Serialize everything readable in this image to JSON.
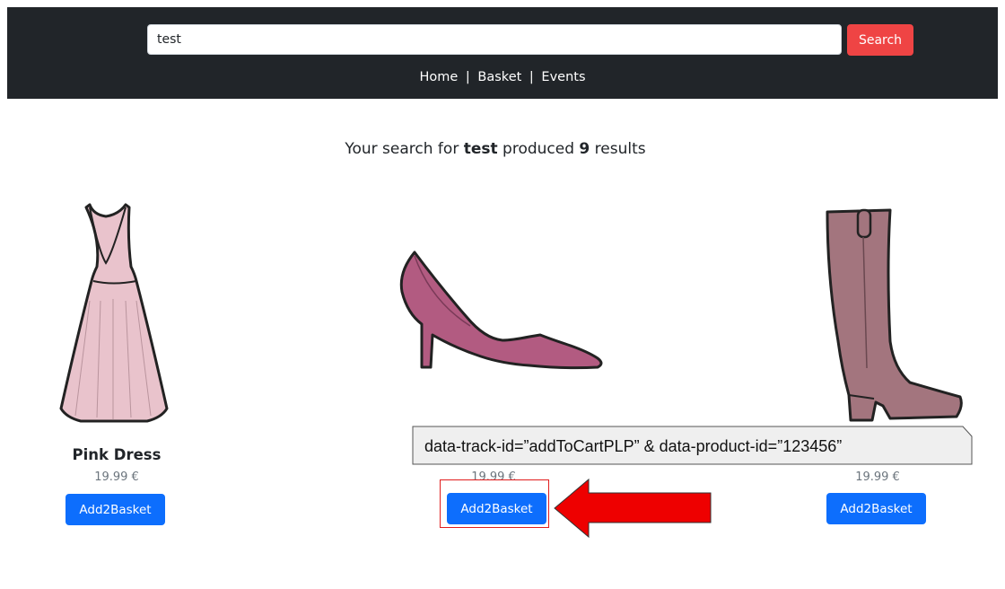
{
  "header": {
    "search": {
      "value": "test",
      "button_label": "Search"
    },
    "nav": {
      "home": "Home",
      "separator": "|",
      "basket": "Basket",
      "events": "Events"
    }
  },
  "results": {
    "prefix": "Your search for",
    "query": "test",
    "middle": "produced",
    "count": "9",
    "suffix": "results"
  },
  "products": [
    {
      "name": "Pink Dress",
      "price": "19.99 €",
      "button": "Add2Basket",
      "image": "pink-dress"
    },
    {
      "name": "",
      "price": "19.99 €",
      "button": "Add2Basket",
      "image": "pink-high-heel"
    },
    {
      "name": "",
      "price": "19.99 €",
      "button": "Add2Basket",
      "image": "brown-boot"
    }
  ],
  "annotation": {
    "callout_text": "data-track-id=”addToCartPLP” & data-product-id=”123456”",
    "arrow_color": "#ee0000",
    "highlight_color": "#e11d1d"
  },
  "colors": {
    "header_bg": "#212529",
    "search_button": "#ef4444",
    "add_button": "#0d6efd",
    "dress": "#e9c3cc",
    "heel": "#b25b81",
    "boot": "#a3757e"
  }
}
